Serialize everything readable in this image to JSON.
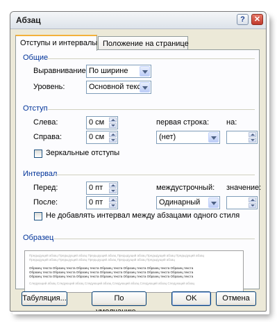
{
  "window": {
    "title": "Абзац",
    "help_label": "?",
    "close_label": "✕"
  },
  "tabs": [
    {
      "label": "Отступы и интервалы",
      "active": true
    },
    {
      "label": "Положение на странице",
      "active": false
    }
  ],
  "general": {
    "section": "Общие",
    "alignment_label": "Выравнивание:",
    "alignment_value": "По ширине",
    "level_label": "Уровень:",
    "level_value": "Основной текст"
  },
  "indent": {
    "section": "Отступ",
    "left_label": "Слева:",
    "left_value": "0 см",
    "right_label": "Справа:",
    "right_value": "0 см",
    "first_line_label": "первая строка:",
    "first_line_value": "(нет)",
    "by_label": "на:",
    "by_value": "",
    "mirror_label": "Зеркальные отступы",
    "mirror_checked": false
  },
  "spacing": {
    "section": "Интервал",
    "before_label": "Перед:",
    "before_value": "0 пт",
    "after_label": "После:",
    "after_value": "0 пт",
    "line_label": "междустрочный:",
    "line_value": "Одинарный",
    "at_label": "значение:",
    "at_value": "",
    "no_space_label": "Не добавлять интервал между абзацами одного стиля",
    "no_space_checked": false
  },
  "preview": {
    "section": "Образец",
    "prev_lines": [
      "Предыдущий абзац Предыдущий абзац Предыдущий абзац Предыдущий абзац Предыдущий абзац Предыдущий абзац",
      "Предыдущий абзац Предыдущий абзац Предыдущий абзац Предыдущий абзац Предыдущий абзац"
    ],
    "sample_lines": [
      "Образец текста Образец текста Образец текста Образец текста Образец текста Образец текста Образец текста",
      "Образец текста Образец текста Образец текста Образец текста Образец текста Образец текста Образец текста",
      "Образец текста Образец текста Образец текста Образец текста Образец текста Образец текста Образец текста"
    ],
    "next_lines": [
      "Следующий абзац Следующий абзац Следующий абзац Следующий абзац Следующий абзац Следующий абзац"
    ]
  },
  "buttons": {
    "tabs": "Табуляция...",
    "default": "По умолчанию...",
    "ok": "OK",
    "cancel": "Отмена"
  }
}
